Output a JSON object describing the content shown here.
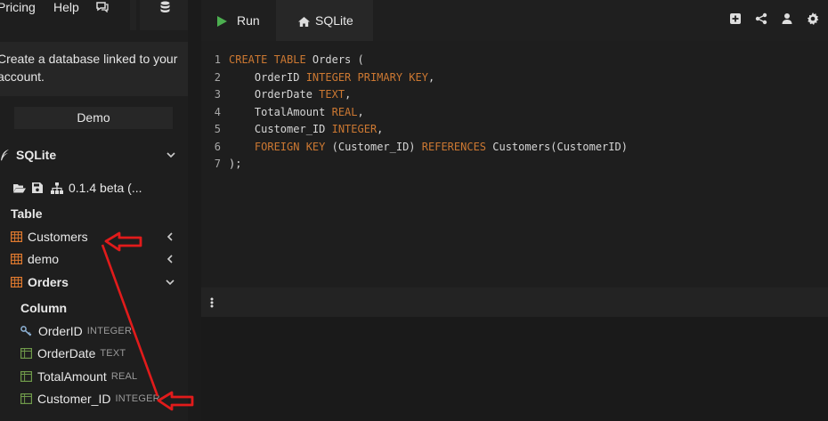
{
  "nav": {
    "pricing": "Pricing",
    "help": "Help"
  },
  "sidebar": {
    "description": "Create a database linked to your account.",
    "demo_button": "Demo",
    "db_name": "SQLite",
    "version": "0.1.4 beta (...",
    "table_header": "Table",
    "tables": [
      {
        "name": "Customers",
        "expanded": false
      },
      {
        "name": "demo",
        "expanded": false
      },
      {
        "name": "Orders",
        "expanded": true
      }
    ],
    "column_header": "Column",
    "columns": [
      {
        "name": "OrderID",
        "type": "INTEGER",
        "key": true
      },
      {
        "name": "OrderDate",
        "type": "TEXT",
        "key": false
      },
      {
        "name": "TotalAmount",
        "type": "REAL",
        "key": false
      },
      {
        "name": "Customer_ID",
        "type": "INTEGER",
        "key": false
      }
    ]
  },
  "toolbar": {
    "run_label": "Run",
    "tab_label": "SQLite"
  },
  "editor": {
    "lines": [
      {
        "num": "1",
        "tokens": [
          [
            "kw",
            "CREATE TABLE"
          ],
          [
            "tx",
            " Orders ("
          ]
        ]
      },
      {
        "num": "2",
        "tokens": [
          [
            "tx",
            "    OrderID "
          ],
          [
            "kw",
            "INTEGER PRIMARY KEY"
          ],
          [
            "tx",
            ","
          ]
        ]
      },
      {
        "num": "3",
        "tokens": [
          [
            "tx",
            "    OrderDate "
          ],
          [
            "kw",
            "TEXT"
          ],
          [
            "tx",
            ","
          ]
        ]
      },
      {
        "num": "4",
        "tokens": [
          [
            "tx",
            "    TotalAmount "
          ],
          [
            "kw",
            "REAL"
          ],
          [
            "tx",
            ","
          ]
        ]
      },
      {
        "num": "5",
        "tokens": [
          [
            "tx",
            "    Customer_ID "
          ],
          [
            "kw",
            "INTEGER"
          ],
          [
            "tx",
            ","
          ]
        ]
      },
      {
        "num": "6",
        "tokens": [
          [
            "tx",
            "    "
          ],
          [
            "kw",
            "FOREIGN KEY"
          ],
          [
            "tx",
            " (Customer_ID) "
          ],
          [
            "kw",
            "REFERENCES"
          ],
          [
            "tx",
            " Customers(CustomerID)"
          ]
        ]
      },
      {
        "num": "7",
        "tokens": [
          [
            "tx",
            ");"
          ]
        ]
      }
    ]
  },
  "colors": {
    "keyword": "#cc7832",
    "run_icon": "#4caf50",
    "table_icon": "#e07a2f",
    "column_icon": "#6f9a4a",
    "key_icon": "#8fb4d8",
    "annotation": "#e11b1b"
  }
}
